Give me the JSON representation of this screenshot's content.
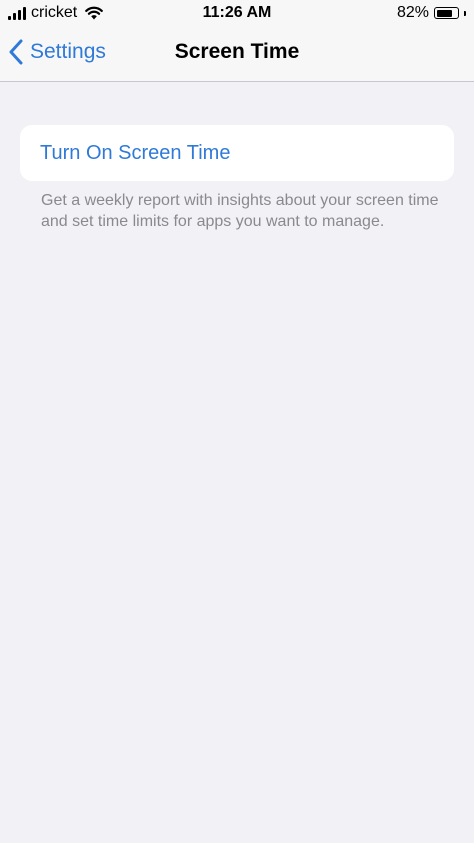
{
  "status_bar": {
    "carrier": "cricket",
    "time": "11:26 AM",
    "battery_percent": "82%",
    "battery_level": 0.82,
    "signal_icon": "cellular-signal-icon",
    "wifi_icon": "wifi-icon",
    "battery_icon": "battery-icon"
  },
  "nav": {
    "back_label": "Settings",
    "back_icon": "chevron-left-icon",
    "title": "Screen Time"
  },
  "main": {
    "turn_on_label": "Turn On Screen Time",
    "footer": "Get a weekly report with insights about your screen time and set time limits for apps you want to manage."
  },
  "colors": {
    "accent": "#2f7ad8",
    "background": "#f1f1f6",
    "secondary_text": "#8a8a8e"
  }
}
